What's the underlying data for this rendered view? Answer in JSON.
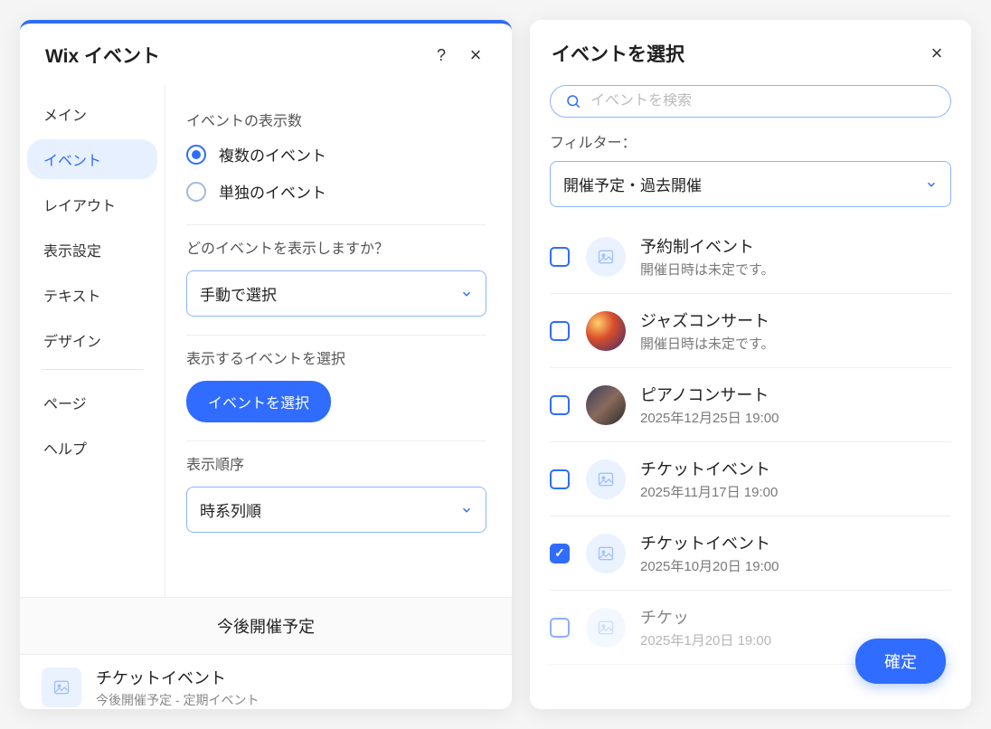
{
  "left": {
    "title": "Wix イベント",
    "nav": {
      "items": [
        {
          "label": "メイン"
        },
        {
          "label": "イベント"
        },
        {
          "label": "レイアウト"
        },
        {
          "label": "表示設定"
        },
        {
          "label": "テキスト"
        },
        {
          "label": "デザイン"
        }
      ],
      "secondary": [
        {
          "label": "ページ"
        },
        {
          "label": "ヘルプ"
        }
      ],
      "active_index": 1
    },
    "sections": {
      "display_count": {
        "label": "イベントの表示数",
        "options": [
          {
            "label": "複数のイベント",
            "selected": true
          },
          {
            "label": "単独のイベント",
            "selected": false
          }
        ]
      },
      "which_events": {
        "label": "どのイベントを表示しますか？",
        "select_value": "手動で選択"
      },
      "choose_events": {
        "label": "表示するイベントを選択",
        "button": "イベントを選択"
      },
      "order": {
        "label": "表示順序",
        "select_value": "時系列順"
      }
    },
    "upcoming_label": "今後開催予定",
    "bottom_item": {
      "title": "チケットイベント",
      "sub": "今後開催予定 - 定期イベント"
    }
  },
  "right": {
    "title": "イベントを選択",
    "search_placeholder": "イベントを検索",
    "filter_label": "フィルター：",
    "filter_value": "開催予定・過去開催",
    "events": [
      {
        "title": "予約制イベント",
        "sub": "開催日時は未定です。",
        "checked": false,
        "thumb": "placeholder"
      },
      {
        "title": "ジャズコンサート",
        "sub": "開催日時は未定です。",
        "checked": false,
        "thumb": "photo1"
      },
      {
        "title": "ピアノコンサート",
        "sub": "2025年12月25日 19:00",
        "checked": false,
        "thumb": "photo2"
      },
      {
        "title": "チケットイベント",
        "sub": "2025年11月17日 19:00",
        "checked": false,
        "thumb": "placeholder"
      },
      {
        "title": "チケットイベント",
        "sub": "2025年10月20日 19:00",
        "checked": true,
        "thumb": "placeholder"
      },
      {
        "title": "チケッ",
        "sub": "2025年1月20日 19:00",
        "checked": false,
        "thumb": "placeholder",
        "faded": true
      }
    ],
    "confirm_label": "確定"
  }
}
